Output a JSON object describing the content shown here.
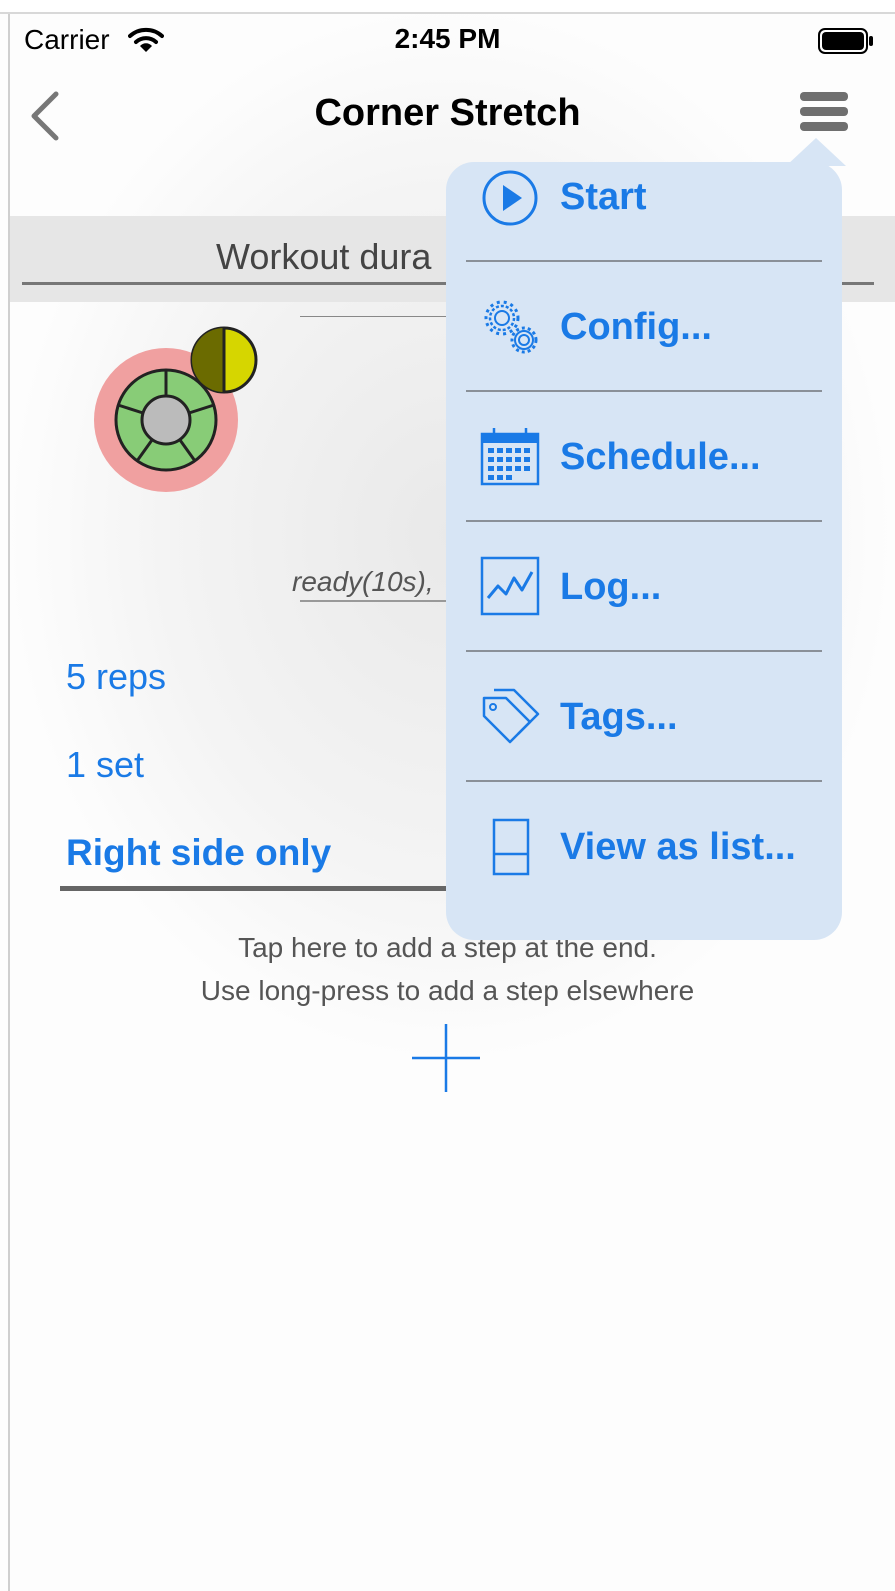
{
  "status_bar": {
    "carrier": "Carrier",
    "time": "2:45 PM",
    "wifi_icon": "wifi-icon",
    "battery_icon": "battery-icon"
  },
  "nav": {
    "title": "Corner Stretch",
    "back_icon": "chevron-left-icon",
    "menu_icon": "hamburger-icon"
  },
  "workout": {
    "duration_label": "Workout dura",
    "ready_text": "ready(10s),",
    "reps": "5 reps",
    "sets": "1 set",
    "side": "Right side only"
  },
  "add_step": {
    "line1": "Tap here to add a step at the end.",
    "line2": "Use long-press to add a step elsewhere"
  },
  "menu": {
    "items": [
      {
        "label": "Start",
        "icon": "play-icon"
      },
      {
        "label": "Config...",
        "icon": "gears-icon"
      },
      {
        "label": "Schedule...",
        "icon": "calendar-icon"
      },
      {
        "label": "Log...",
        "icon": "chart-log-icon"
      },
      {
        "label": "Tags...",
        "icon": "tags-icon"
      },
      {
        "label": "View as list...",
        "icon": "list-view-icon"
      }
    ]
  },
  "colors": {
    "accent": "#1a7ae6",
    "menu_background": "#d7e5f5",
    "icon_ring": "#f0a0a0",
    "icon_wheel": "#88cc77",
    "icon_badge": "#d6d600"
  }
}
